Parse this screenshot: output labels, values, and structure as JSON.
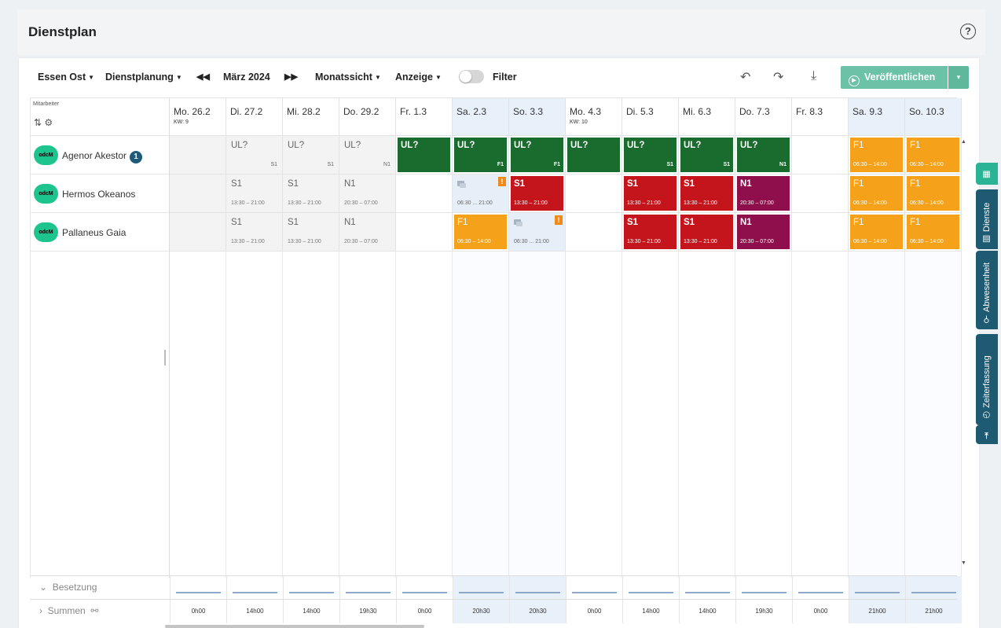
{
  "page": {
    "title": "Dienstplan",
    "help_icon": "?"
  },
  "toolbar": {
    "location": "Essen Ost",
    "planning": "Dienstplanung",
    "prev_icon": "◀◀",
    "month": "März 2024",
    "next_icon": "▶▶",
    "view": "Monatssicht",
    "display": "Anzeige",
    "filter_label": "Filter",
    "filter_on": false,
    "undo_icon": "↶",
    "redo_icon": "↷",
    "download_icon": "⤓",
    "publish_label": "Veröffentlichen",
    "publish_icon": "▶",
    "publish_dropdown": "▾",
    "accent": "#6cc2a6"
  },
  "employees_header": {
    "label": "Mitarbeiter",
    "icons": "⇅ ⚙"
  },
  "employees": [
    {
      "avatar": "odcM",
      "name": "Agenor Akestor",
      "badge": "1"
    },
    {
      "avatar": "odcM",
      "name": "Hermos Okeanos",
      "badge": ""
    },
    {
      "avatar": "odcM",
      "name": "Pallaneus Gaia",
      "badge": ""
    }
  ],
  "days": [
    {
      "label": "Mo. 26.2",
      "kw": "KW: 9",
      "weekend": false
    },
    {
      "label": "Di. 27.2",
      "kw": "",
      "weekend": false
    },
    {
      "label": "Mi. 28.2",
      "kw": "",
      "weekend": false
    },
    {
      "label": "Do. 29.2",
      "kw": "",
      "weekend": false
    },
    {
      "label": "Fr. 1.3",
      "kw": "",
      "weekend": false
    },
    {
      "label": "Sa. 2.3",
      "kw": "",
      "weekend": true
    },
    {
      "label": "So. 3.3",
      "kw": "",
      "weekend": true
    },
    {
      "label": "Mo. 4.3",
      "kw": "KW: 10",
      "weekend": false
    },
    {
      "label": "Di. 5.3",
      "kw": "",
      "weekend": false
    },
    {
      "label": "Mi. 6.3",
      "kw": "",
      "weekend": false
    },
    {
      "label": "Do. 7.3",
      "kw": "",
      "weekend": false
    },
    {
      "label": "Fr. 8.3",
      "kw": "",
      "weekend": false
    },
    {
      "label": "Sa. 9.3",
      "kw": "",
      "weekend": true
    },
    {
      "label": "So. 10.3",
      "kw": "",
      "weekend": true
    }
  ],
  "schedule": [
    [
      {
        "type": "blank",
        "bg": "gray"
      },
      {
        "type": "grey",
        "code": "UL?",
        "sub": "S1",
        "bg": "gray"
      },
      {
        "type": "grey",
        "code": "UL?",
        "sub": "S1",
        "bg": "gray"
      },
      {
        "type": "grey",
        "code": "UL?",
        "sub": "N1",
        "bg": "gray"
      },
      {
        "type": "green",
        "code": "UL?"
      },
      {
        "type": "green",
        "code": "UL?",
        "sub": "F1"
      },
      {
        "type": "green",
        "code": "UL?",
        "sub": "F1"
      },
      {
        "type": "green",
        "code": "UL?"
      },
      {
        "type": "green",
        "code": "UL?",
        "sub": "S1"
      },
      {
        "type": "green",
        "code": "UL?",
        "sub": "S1"
      },
      {
        "type": "green",
        "code": "UL?",
        "sub": "N1"
      },
      {
        "type": "blank"
      },
      {
        "type": "orange",
        "code": "F1",
        "time": "06:30 – 14:00"
      },
      {
        "type": "orange",
        "code": "F1",
        "time": "06:30 – 14:00"
      }
    ],
    [
      {
        "type": "blank",
        "bg": "gray"
      },
      {
        "type": "grey",
        "code": "S1",
        "time": "13:30 – 21:00",
        "bg": "gray"
      },
      {
        "type": "grey",
        "code": "S1",
        "time": "13:30 – 21:00",
        "bg": "gray"
      },
      {
        "type": "grey",
        "code": "N1",
        "time": "20:30 – 07:00",
        "bg": "gray"
      },
      {
        "type": "blank"
      },
      {
        "type": "lb",
        "time": "06:30 ... 21:00",
        "warn": "!",
        "bg": "lb"
      },
      {
        "type": "red",
        "code": "S1",
        "time": "13:30 – 21:00"
      },
      {
        "type": "blank"
      },
      {
        "type": "red",
        "code": "S1",
        "time": "13:30 – 21:00"
      },
      {
        "type": "red",
        "code": "S1",
        "time": "13:30 – 21:00"
      },
      {
        "type": "purple",
        "code": "N1",
        "time": "20:30 – 07:00"
      },
      {
        "type": "blank"
      },
      {
        "type": "orange",
        "code": "F1",
        "time": "06:30 – 14:00"
      },
      {
        "type": "orange",
        "code": "F1",
        "time": "06:30 – 14:00"
      }
    ],
    [
      {
        "type": "blank",
        "bg": "gray"
      },
      {
        "type": "grey",
        "code": "S1",
        "time": "13:30 – 21:00",
        "bg": "gray"
      },
      {
        "type": "grey",
        "code": "S1",
        "time": "13:30 – 21:00",
        "bg": "gray"
      },
      {
        "type": "grey",
        "code": "N1",
        "time": "20:30 – 07:00",
        "bg": "gray"
      },
      {
        "type": "blank"
      },
      {
        "type": "orange",
        "code": "F1",
        "time": "06:30 – 14:00"
      },
      {
        "type": "lb",
        "time": "06:30 ... 21:00",
        "warn": "!",
        "bg": "lb"
      },
      {
        "type": "blank"
      },
      {
        "type": "red",
        "code": "S1",
        "time": "13:30 – 21:00"
      },
      {
        "type": "red",
        "code": "S1",
        "time": "13:30 – 21:00"
      },
      {
        "type": "purple",
        "code": "N1",
        "time": "20:30 – 07:00"
      },
      {
        "type": "blank"
      },
      {
        "type": "orange",
        "code": "F1",
        "time": "06:30 – 14:00"
      },
      {
        "type": "orange",
        "code": "F1",
        "time": "06:30 – 14:00"
      }
    ]
  ],
  "bottom": {
    "besetzung_label": "Besetzung",
    "summen_label": "Summen",
    "besetzung_icon": "⌄",
    "summen_icon": "›",
    "summen_extra_icon": "⚯",
    "sums": [
      "0h00",
      "14h00",
      "14h00",
      "19h30",
      "0h00",
      "20h30",
      "20h30",
      "0h00",
      "14h00",
      "14h00",
      "19h30",
      "0h00",
      "21h00",
      "21h00"
    ]
  },
  "side_tabs": [
    {
      "label": "",
      "icon": "▦",
      "active": true
    },
    {
      "label": "Dienste",
      "icon": "▤",
      "active": false
    },
    {
      "label": "Abwesenheit",
      "icon": "⚲",
      "active": false
    },
    {
      "label": "Zeiterfassung",
      "icon": "◷",
      "active": false
    },
    {
      "label": "",
      "icon": "⇥",
      "active": false
    }
  ]
}
